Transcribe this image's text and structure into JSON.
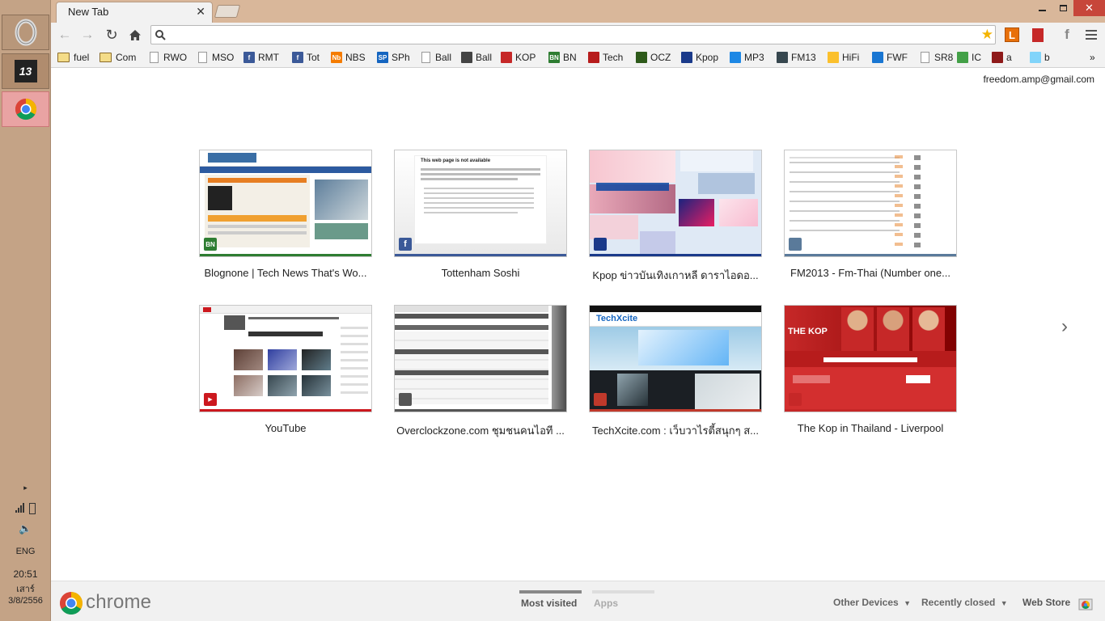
{
  "taskbar": {
    "network_label": "",
    "language": "ENG",
    "time": "20:51",
    "day": "เสาร์",
    "date": "3/8/2556",
    "app2_label": "13"
  },
  "tab": {
    "title": "New Tab"
  },
  "omnibox": {
    "value": "",
    "placeholder": ""
  },
  "bookmarks": [
    {
      "label": "fuel",
      "icon": "folder-icon"
    },
    {
      "label": "Com",
      "icon": "folder-icon"
    },
    {
      "label": "RWO",
      "icon": "page-icon"
    },
    {
      "label": "MSO",
      "icon": "page-icon"
    },
    {
      "label": "RMT",
      "icon": "facebook-icon"
    },
    {
      "label": "Tot",
      "icon": "facebook-icon"
    },
    {
      "label": "NBS",
      "icon": "nb-icon",
      "badge": "Nb"
    },
    {
      "label": "SPh",
      "icon": "sp-icon",
      "badge": "SP"
    },
    {
      "label": "Ball",
      "icon": "page-icon"
    },
    {
      "label": "Ball",
      "icon": "ball-icon"
    },
    {
      "label": "KOP",
      "icon": "kop-icon"
    },
    {
      "label": "BN",
      "icon": "bn-icon",
      "badge": "BN"
    },
    {
      "label": "Tech",
      "icon": "tech-icon"
    },
    {
      "label": "OCZ",
      "icon": "ocz-icon"
    },
    {
      "label": "Kpop",
      "icon": "kpop-icon"
    },
    {
      "label": "MP3",
      "icon": "mp3-icon"
    },
    {
      "label": "FM13",
      "icon": "fm13-icon"
    },
    {
      "label": "HiFi",
      "icon": "hifi-icon"
    },
    {
      "label": "FWF",
      "icon": "fwf-icon"
    },
    {
      "label": "SR8",
      "icon": "page-icon"
    },
    {
      "label": "IC",
      "icon": "ic-icon"
    },
    {
      "label": "a",
      "icon": "a-icon"
    },
    {
      "label": "b",
      "icon": "b-icon"
    }
  ],
  "user_email": "freedom.amp@gmail.com",
  "tiles": [
    {
      "title": "Blognone | Tech News That's Wo...",
      "fav": "BN",
      "color": "#2e7d32"
    },
    {
      "title": "Tottenham Soshi",
      "fav": "f",
      "color": "#3b5998",
      "thumb_heading": "This web page is not available"
    },
    {
      "title": "Kpop ข่าวบันเทิงเกาหลี ดาราไอดอ...",
      "fav": "",
      "color": "#1a3a8a"
    },
    {
      "title": "FM2013 - Fm-Thai (Number one...",
      "fav": "",
      "color": "#5a7a9a"
    },
    {
      "title": "YouTube",
      "fav": "▶",
      "color": "#cc181e"
    },
    {
      "title": "Overclockzone.com ชุมชนคนไอที ...",
      "fav": "",
      "color": "#555"
    },
    {
      "title": "TechXcite.com : เว็บวาไรตี้สนุกๆ ส...",
      "fav": "",
      "color": "#c0392b",
      "thumb_heading": "TechXcite"
    },
    {
      "title": "The Kop in Thailand - Liverpool",
      "fav": "",
      "color": "#c62828",
      "thumb_heading": "THE KOP"
    }
  ],
  "footer": {
    "logo": "chrome",
    "tabs": [
      "Most visited",
      "Apps"
    ],
    "other_devices": "Other Devices",
    "recently_closed": "Recently closed",
    "web_store": "Web Store"
  },
  "colors": {
    "accent_blue": "#4285f4",
    "chrome_red": "#db4437",
    "chrome_yellow": "#f4b400",
    "chrome_green": "#0f9d58"
  }
}
